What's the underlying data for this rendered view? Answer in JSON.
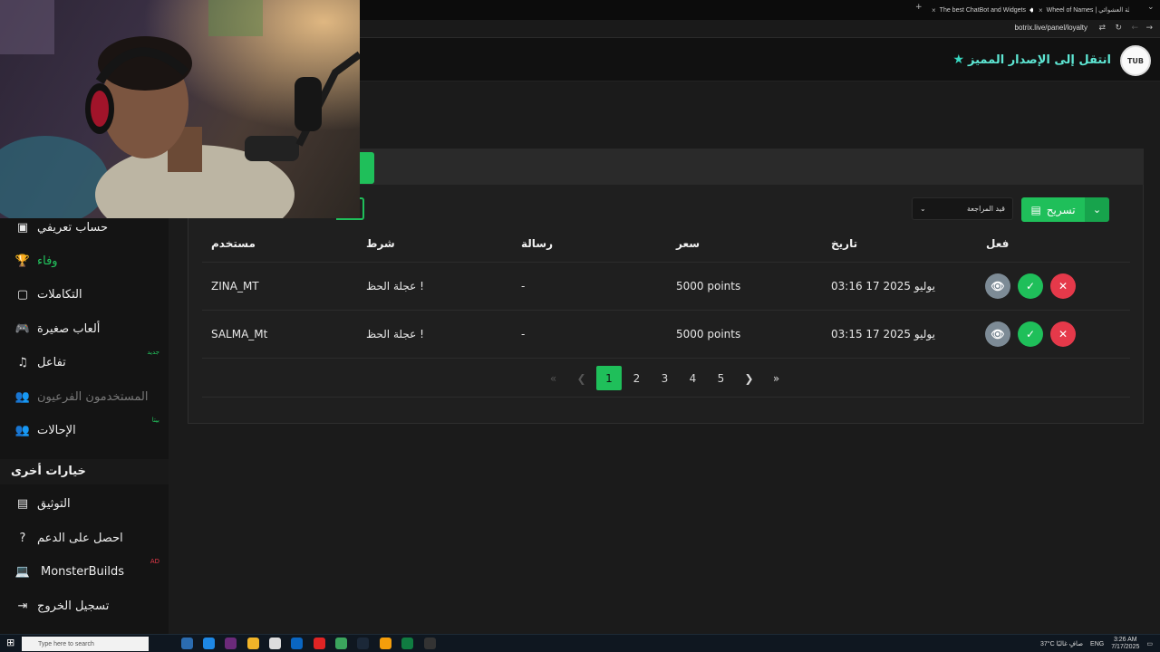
{
  "browser": {
    "tabs": [
      {
        "title": "The best ChatBot and Widgets"
      },
      {
        "title": "Wheel of Names | عجلة العشوائي"
      }
    ],
    "url": "botrix.live/panel/loyalty"
  },
  "header": {
    "premium_text": "انتقل إلى الإصدار المميز",
    "logo_text": "TUB"
  },
  "toolbar": {
    "export_label": "تسريح",
    "status_select": "قيد المراجعة"
  },
  "table": {
    "columns": {
      "action": "فعل",
      "date": "تاريخ",
      "price": "سعر",
      "message": "رسالة",
      "condition": "شرط",
      "user": "مستخدم"
    },
    "rows": [
      {
        "user": "ZINA_MT",
        "condition": "عجلة الحظ !",
        "message": "-",
        "price": "5000 points",
        "date": "يوليو 2025 17 03:16"
      },
      {
        "user": "SALMA_Mt",
        "condition": "عجلة الحظ !",
        "message": "-",
        "price": "5000 points",
        "date": "يوليو 2025 17 03:15"
      }
    ]
  },
  "pagination": {
    "pages": [
      "1",
      "2",
      "3",
      "4",
      "5"
    ],
    "current": "1"
  },
  "sidebar": {
    "items": [
      {
        "label": "حساب تعريفي",
        "icon": "id-card-icon"
      },
      {
        "label": "وفاء",
        "icon": "trophy-icon",
        "active": true
      },
      {
        "label": "التكاملات",
        "icon": "plug-icon"
      },
      {
        "label": "ألعاب صغيرة",
        "icon": "gamepad-icon"
      },
      {
        "label": "تفاعل",
        "icon": "music-icon",
        "badge": "جديد"
      },
      {
        "label": "المستخدمون الفرعيون",
        "icon": "users-icon",
        "disabled": true
      },
      {
        "label": "الإحالات",
        "icon": "user-group-icon",
        "badge": "بيتا"
      }
    ],
    "other_title": "خيارات أخرى",
    "other_items": [
      {
        "label": "التوثيق",
        "icon": "document-icon"
      },
      {
        "label": "احصل على الدعم",
        "icon": "question-icon"
      },
      {
        "label": "MonsterBuilds",
        "icon": "laptop-icon",
        "badge": "AD"
      },
      {
        "label": "تسجيل الخروج",
        "icon": "logout-icon"
      }
    ],
    "badge_colors": {
      "new": "#22c55e",
      "beta": "#22c55e",
      "ad": "#e5394a"
    }
  },
  "taskbar": {
    "search_placeholder": "Type here to search",
    "weather": "37°C صافٍ غالبًا",
    "lang": "ENG",
    "time": "3:26 AM",
    "date": "7/17/2025"
  },
  "colors": {
    "accent": "#1fbf5a",
    "danger": "#e5394a",
    "premium": "#5ee7d4"
  }
}
